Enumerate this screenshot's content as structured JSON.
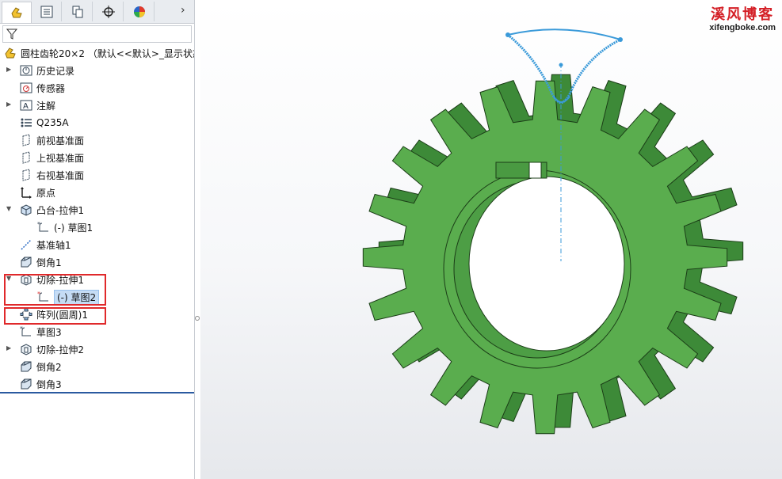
{
  "tabs": [
    {
      "name": "feature-manager",
      "icon": "feature-manager-icon"
    },
    {
      "name": "property-manager",
      "icon": "property-manager-icon"
    },
    {
      "name": "configuration-manager",
      "icon": "configuration-manager-icon"
    },
    {
      "name": "dimxpert-manager",
      "icon": "dimxpert-icon"
    },
    {
      "name": "display-manager",
      "icon": "display-manager-icon"
    }
  ],
  "tab_more_glyph": "›",
  "root": {
    "label": "圆柱齿轮20×2 （默认<<默认>_显示状态"
  },
  "tree": {
    "items": [
      {
        "label": "历史记录",
        "icon": "history-icon"
      },
      {
        "label": "传感器",
        "icon": "sensor-icon"
      },
      {
        "label": "注解",
        "icon": "annotation-icon"
      },
      {
        "label": "Q235A",
        "icon": "material-icon"
      },
      {
        "label": "前视基准面",
        "icon": "plane-icon"
      },
      {
        "label": "上视基准面",
        "icon": "plane-icon"
      },
      {
        "label": "右视基准面",
        "icon": "plane-icon"
      },
      {
        "label": "原点",
        "icon": "origin-icon"
      },
      {
        "label": "凸台-拉伸1",
        "icon": "boss-extrude-icon"
      },
      {
        "label": "(-) 草图1",
        "icon": "sketch-icon"
      },
      {
        "label": "基准轴1",
        "icon": "axis-icon"
      },
      {
        "label": "倒角1",
        "icon": "chamfer-icon"
      },
      {
        "label": "切除-拉伸1",
        "icon": "cut-extrude-icon"
      },
      {
        "label": "(-) 草图2",
        "icon": "sketch-icon"
      },
      {
        "label": "阵列(圆周)1",
        "icon": "circular-pattern-icon"
      },
      {
        "label": "草图3",
        "icon": "sketch-icon"
      },
      {
        "label": "切除-拉伸2",
        "icon": "cut-extrude-icon"
      },
      {
        "label": "倒角2",
        "icon": "chamfer-icon"
      },
      {
        "label": "倒角3",
        "icon": "chamfer-icon"
      }
    ]
  },
  "watermark": {
    "title": "溪风博客",
    "url": "xifengboke.com"
  },
  "colors": {
    "gear_face": "#5aad4e",
    "gear_side": "#3d8a38",
    "edge": "#1b3d17",
    "sketch": "#3a9ad9",
    "highlight": "#e0292b"
  }
}
